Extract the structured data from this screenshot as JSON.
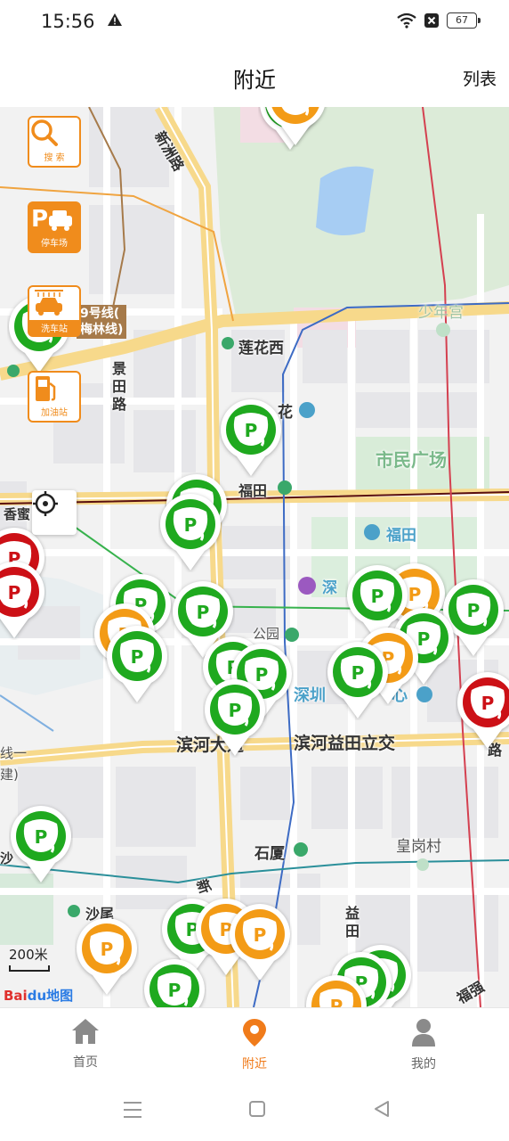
{
  "status_bar": {
    "time": "15:56",
    "battery": "67"
  },
  "header": {
    "title": "附近",
    "list_button": "列表"
  },
  "map_tools": [
    {
      "label": "搜 索",
      "icon": "search-icon"
    },
    {
      "label": "停车场",
      "icon": "parking-icon"
    },
    {
      "label": "洗车站",
      "icon": "car-wash-icon"
    },
    {
      "label": "加油站",
      "icon": "fuel-icon"
    }
  ],
  "map_labels": {
    "road_xinzhou": "新洲路",
    "road_jingtian": "景田路",
    "metro_line9": "9号线(\n梅林线)",
    "lianhuaxi": "莲花西",
    "shaonian": "少年宫",
    "futian": "福田",
    "civic_square": "市民广场",
    "futian2": "福田",
    "huachang": "花",
    "xiangmi": "香蜜",
    "shen": "深",
    "park": "公园",
    "shenzhen_center": "深圳",
    "center": "心",
    "binhe": "滨河大道",
    "binhe_yitian": "滨河益田立交",
    "line1": "线一",
    "jian": "建)",
    "shixia": "石厦",
    "huanggang": "皇岗村",
    "shawei": "沙尾",
    "yitian_road": "益田",
    "xin": "新",
    "road_right": "路",
    "fuqiang": "福强",
    "sha": "沙"
  },
  "scale": "200米",
  "baidu_logo": "Bai",
  "baidu_logo_tail": "du地图",
  "colors": {
    "green_pin": "#1fa91f",
    "orange_pin": "#f39b16",
    "red_pin": "#cc1016",
    "accent": "#f07b1a"
  },
  "pins": [
    {
      "color": "green"
    },
    {
      "color": "orange"
    },
    {
      "color": "green"
    },
    {
      "color": "green"
    },
    {
      "color": "green"
    },
    {
      "color": "green"
    },
    {
      "color": "red"
    },
    {
      "color": "green"
    },
    {
      "color": "green"
    },
    {
      "color": "orange"
    },
    {
      "color": "green"
    },
    {
      "color": "green"
    },
    {
      "color": "green"
    },
    {
      "color": "green"
    },
    {
      "color": "orange"
    },
    {
      "color": "green"
    },
    {
      "color": "green"
    },
    {
      "color": "green"
    },
    {
      "color": "orange"
    },
    {
      "color": "green"
    },
    {
      "color": "red"
    },
    {
      "color": "red"
    },
    {
      "color": "orange"
    },
    {
      "color": "green"
    },
    {
      "color": "green"
    },
    {
      "color": "orange"
    },
    {
      "color": "orange"
    },
    {
      "color": "green"
    },
    {
      "color": "green"
    },
    {
      "color": "green"
    },
    {
      "color": "orange"
    }
  ],
  "bottom_nav": [
    {
      "label": "首页",
      "icon": "home-icon",
      "active": false
    },
    {
      "label": "附近",
      "icon": "location-pin-icon",
      "active": true
    },
    {
      "label": "我的",
      "icon": "user-icon",
      "active": false
    }
  ]
}
